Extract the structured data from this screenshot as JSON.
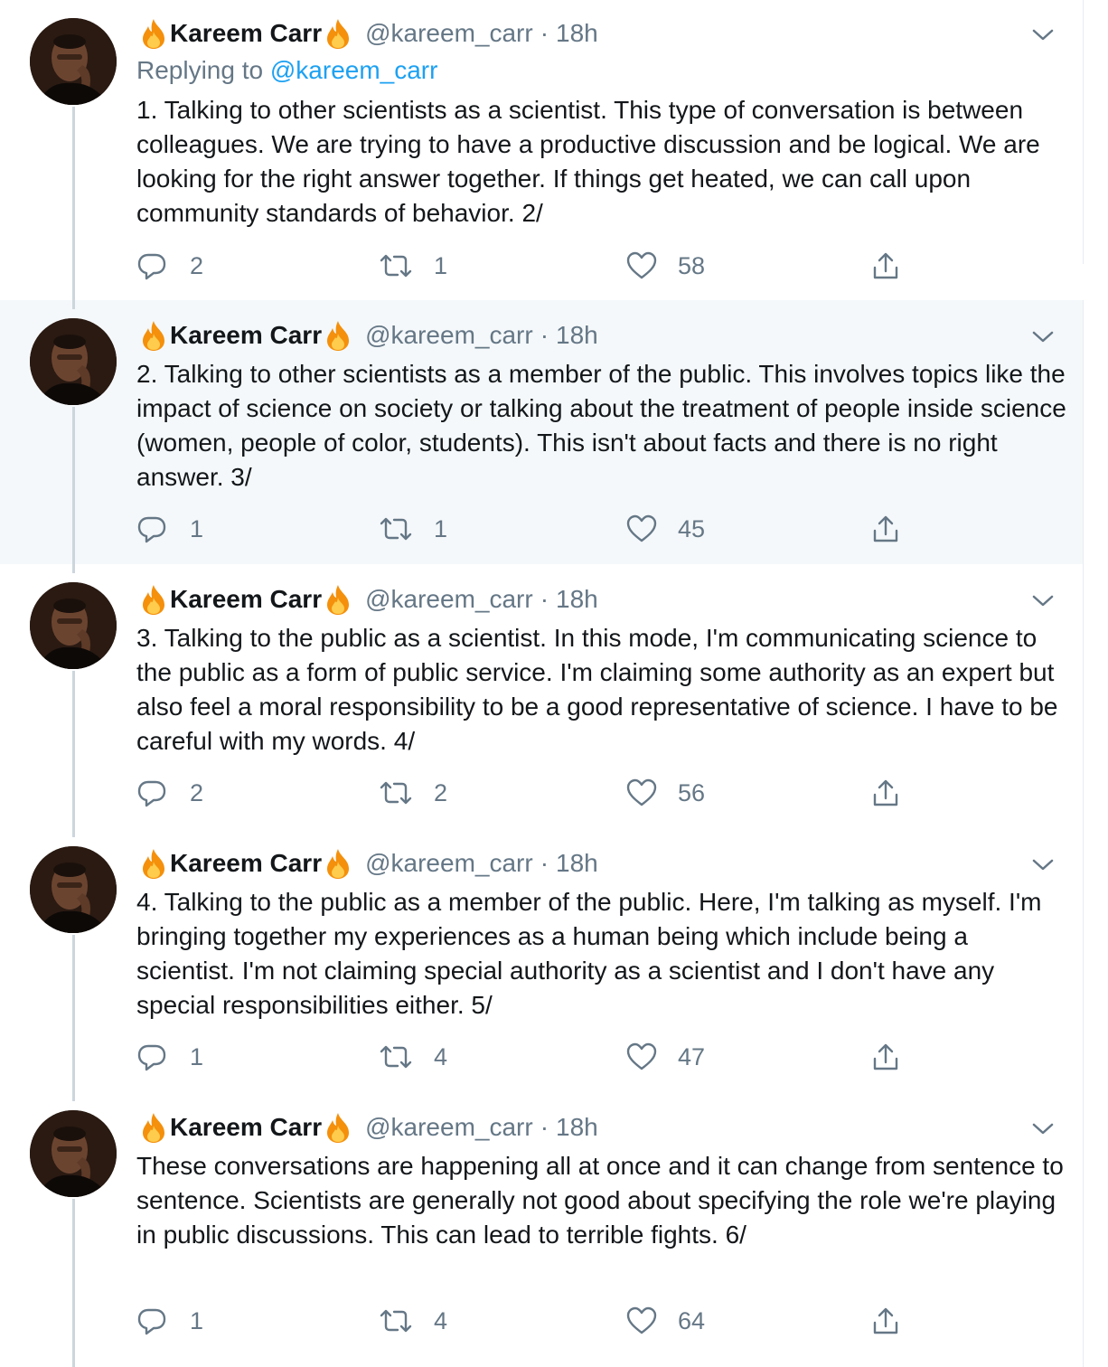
{
  "colors": {
    "accent": "#1da1f2",
    "secondary_text": "#657786",
    "highlight_bg": "#f5f8fa",
    "thread_line": "#ccd6dd"
  },
  "author": {
    "display_name": "Kareem Carr",
    "handle": "@kareem_carr",
    "emoji": "fire-emoji",
    "separator": "·"
  },
  "tweets": [
    {
      "time": "18h",
      "replying_prefix": "Replying to",
      "replying_to": "@kareem_carr",
      "text": "1. Talking to other scientists as a scientist.  This type of conversation is between colleagues. We are trying to have a productive discussion and be logical. We are looking for the right answer together. If things get heated, we can call upon community standards of behavior. 2/",
      "replies": "2",
      "retweets": "1",
      "likes": "58"
    },
    {
      "time": "18h",
      "text": "2. Talking to other scientists as a member of the public. This involves topics like the impact of science on society or talking about the treatment of people inside science (women, people of color, students). This isn't about facts and there is no right answer. 3/",
      "replies": "1",
      "retweets": "1",
      "likes": "45"
    },
    {
      "time": "18h",
      "text": "3. Talking to the public as a scientist. In this mode, I'm communicating science to the public as a form of public service. I'm claiming some authority as an expert but also feel a moral responsibility to be a good representative of science. I have to be careful with my words. 4/",
      "replies": "2",
      "retweets": "2",
      "likes": "56"
    },
    {
      "time": "18h",
      "text": "4. Talking to the public as a member of the public. Here, I'm talking as myself. I'm bringing together my experiences as a human being which include being a scientist. I'm not claiming special authority as a scientist and I don't have any special responsibilities either. 5/",
      "replies": "1",
      "retweets": "4",
      "likes": "47"
    },
    {
      "time": "18h",
      "text": "These conversations are happening all at once and it can change from sentence to sentence. Scientists are generally not good about specifying the role we're playing in public discussions. This can lead to terrible fights. 6/",
      "replies": "1",
      "retweets": "4",
      "likes": "64"
    }
  ]
}
